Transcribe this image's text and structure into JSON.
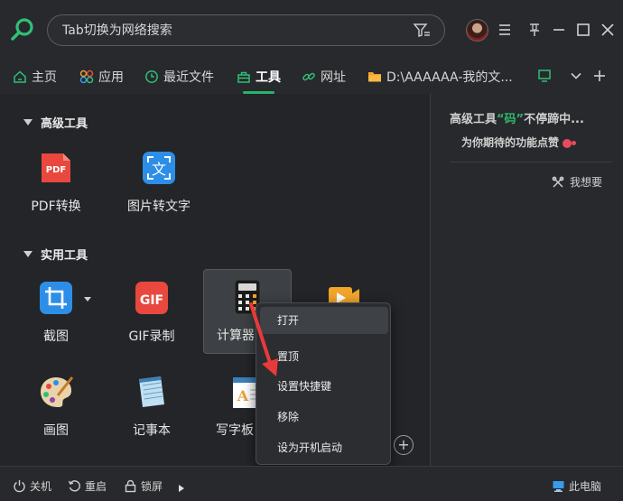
{
  "search": {
    "placeholder": "Tab切换为网络搜索"
  },
  "tabs": [
    {
      "label": "主页",
      "icon": "home-icon"
    },
    {
      "label": "应用",
      "icon": "apps-icon"
    },
    {
      "label": "最近文件",
      "icon": "clock-icon"
    },
    {
      "label": "工具",
      "icon": "toolbox-icon",
      "active": true
    },
    {
      "label": "网址",
      "icon": "link-icon"
    },
    {
      "label": "D:\\AAAAAA-我的文...",
      "icon": "folder-icon"
    }
  ],
  "sections": {
    "advanced": {
      "title": "高级工具"
    },
    "utility": {
      "title": "实用工具"
    }
  },
  "tools": {
    "pdf": {
      "label": "PDF转换",
      "icon_text": "PDF"
    },
    "ocr": {
      "label": "图片转文字",
      "icon_text": "文"
    },
    "screenshot": {
      "label": "截图"
    },
    "gif": {
      "label": "GIF录制",
      "icon_text": "GIF"
    },
    "calculator": {
      "label": "计算器"
    },
    "paint": {
      "label": "画图"
    },
    "notepad": {
      "label": "记事本"
    },
    "wordpad": {
      "label": "写字板"
    }
  },
  "right_panel": {
    "title_prefix": "高级工具",
    "title_highlight": "“码”",
    "title_suffix": "不停蹄中...",
    "subtitle": "为你期待的功能点赞",
    "wish_label": "我想要"
  },
  "context_menu": {
    "items": [
      "打开",
      "置顶",
      "设置快捷键",
      "移除",
      "设为开机启动"
    ]
  },
  "bottom_bar": {
    "shutdown": "关机",
    "restart": "重启",
    "lock": "锁屏",
    "this_pc": "此电脑"
  },
  "colors": {
    "accent": "#26b36a",
    "background": "#27292c",
    "panel": "#232528",
    "menu": "#2b2d30",
    "arrow": "#e83a3a"
  }
}
